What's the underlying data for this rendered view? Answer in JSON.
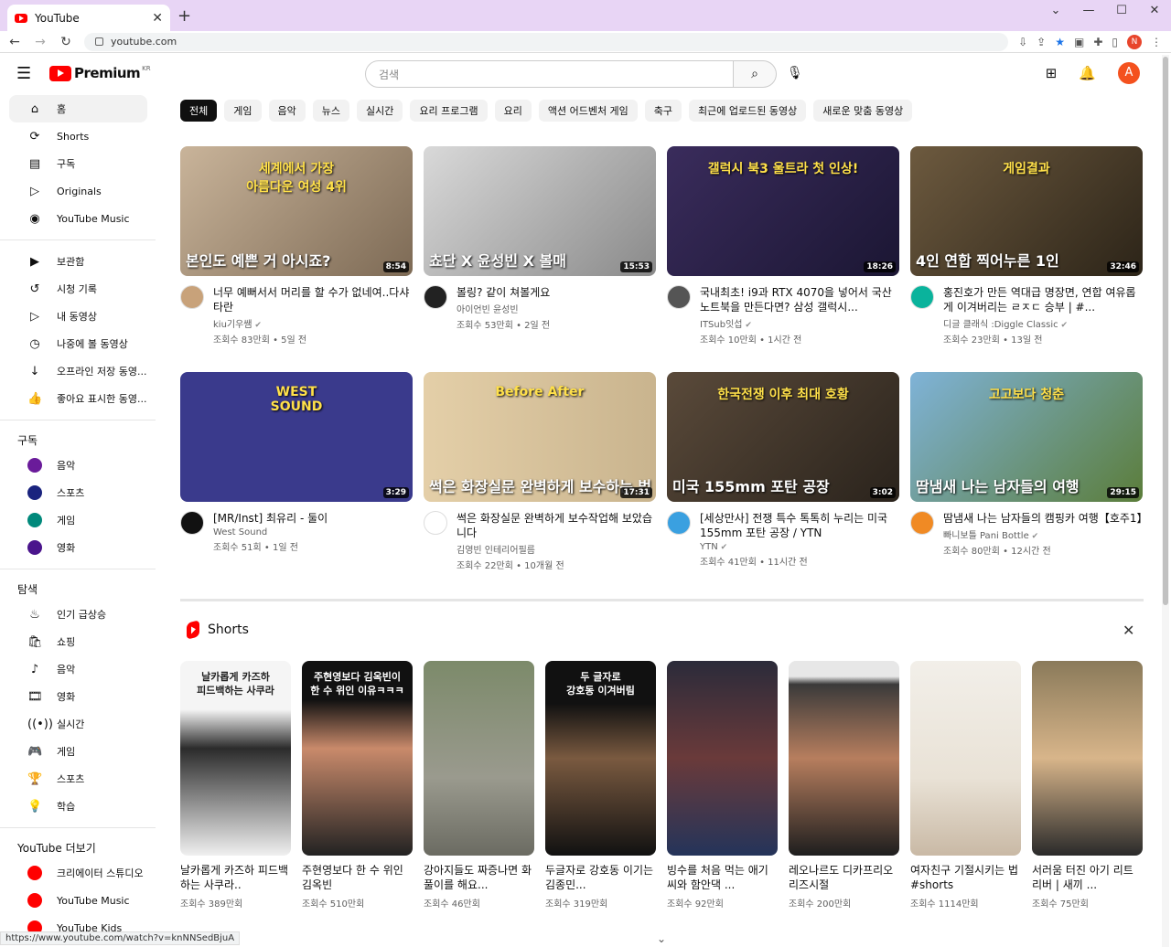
{
  "browser": {
    "tab_title": "YouTube",
    "tab_close": "✕",
    "new_tab": "+",
    "url": "youtube.com",
    "status_url": "https://www.youtube.com/watch?v=knNNSedBjuA"
  },
  "header": {
    "logo_text": "Premium",
    "region": "KR",
    "search_placeholder": "검색",
    "avatar_letter": "A"
  },
  "sidebar": {
    "main": [
      {
        "label": "홈",
        "icon": "home-icon",
        "glyph": "⌂"
      },
      {
        "label": "Shorts",
        "icon": "shorts-icon",
        "glyph": "⟳"
      },
      {
        "label": "구독",
        "icon": "subscriptions-icon",
        "glyph": "▤"
      },
      {
        "label": "Originals",
        "icon": "originals-icon",
        "glyph": "▷"
      },
      {
        "label": "YouTube Music",
        "icon": "music-icon",
        "glyph": "◉"
      }
    ],
    "library": [
      {
        "label": "보관함",
        "icon": "library-icon",
        "glyph": "▶"
      },
      {
        "label": "시청 기록",
        "icon": "history-icon",
        "glyph": "↺"
      },
      {
        "label": "내 동영상",
        "icon": "your-videos-icon",
        "glyph": "▷"
      },
      {
        "label": "나중에 볼 동영상",
        "icon": "watch-later-icon",
        "glyph": "◷"
      },
      {
        "label": "오프라인 저장 동영...",
        "icon": "download-icon",
        "glyph": "↓"
      },
      {
        "label": "좋아요 표시한 동영...",
        "icon": "like-icon",
        "glyph": "👍"
      }
    ],
    "subs_heading": "구독",
    "subs": [
      {
        "label": "음악",
        "color": "#6a1b9a"
      },
      {
        "label": "스포츠",
        "color": "#1a237e"
      },
      {
        "label": "게임",
        "color": "#00897b"
      },
      {
        "label": "영화",
        "color": "#4a148c"
      }
    ],
    "explore_heading": "탐색",
    "explore": [
      {
        "label": "인기 급상승",
        "icon": "trending-icon",
        "glyph": "♨"
      },
      {
        "label": "쇼핑",
        "icon": "shopping-icon",
        "glyph": "🛍"
      },
      {
        "label": "음악",
        "icon": "music-note-icon",
        "glyph": "♪"
      },
      {
        "label": "영화",
        "icon": "movies-icon",
        "glyph": "🎞"
      },
      {
        "label": "실시간",
        "icon": "live-icon",
        "glyph": "((•))"
      },
      {
        "label": "게임",
        "icon": "gaming-icon",
        "glyph": "🎮"
      },
      {
        "label": "스포츠",
        "icon": "trophy-icon",
        "glyph": "🏆"
      },
      {
        "label": "학습",
        "icon": "learning-icon",
        "glyph": "💡"
      }
    ],
    "more_heading": "YouTube 더보기",
    "more": [
      {
        "label": "크리에이터 스튜디오",
        "color": "#ff0000"
      },
      {
        "label": "YouTube Music",
        "color": "#ff0000"
      },
      {
        "label": "YouTube Kids",
        "color": "#ff0000"
      }
    ]
  },
  "chips": [
    "전체",
    "게임",
    "음악",
    "뉴스",
    "실시간",
    "요리 프로그램",
    "요리",
    "액션 어드벤처 게임",
    "축구",
    "최근에 업로드된 동영상",
    "새로운 맞춤 동영상"
  ],
  "videos": [
    {
      "title": "너무 예뻐서서 머리를 할 수가 없네여..다샤 타란",
      "channel": "kiu기우쌤",
      "verified": true,
      "stats": "조회수 83만회 • 5일 전",
      "duration": "8:54",
      "caption": "본인도 예쁜 거 아시죠?",
      "overlay": "세계에서 가장\n아름다운 여성 4위",
      "bg": "linear-gradient(135deg,#c9b49a,#7d6a55)",
      "avatar": "#c8a27a"
    },
    {
      "title": "볼링? 같이 쳐볼게요",
      "channel": "아이언빈 윤성빈",
      "verified": false,
      "stats": "조회수 53만회 • 2일 전",
      "duration": "15:53",
      "caption": "쵸단 X 윤성빈 X 볼매",
      "overlay": "",
      "bg": "linear-gradient(135deg,#d9d9d9,#8a8a8a)",
      "avatar": "#222"
    },
    {
      "title": "국내최초! i9과 RTX 4070을 넣어서 국산 노트북을 만든다면? 삼성 갤럭시...",
      "channel": "ITSub잇섭",
      "verified": true,
      "stats": "조회수 10만회 • 1시간 전",
      "duration": "18:26",
      "caption": "",
      "overlay": "갤럭시 북3 울트라 첫 인상!",
      "bg": "linear-gradient(135deg,#3a2c5c,#1b1633)",
      "avatar": "#555"
    },
    {
      "title": "홍진호가 만든 역대급 명장면, 연합 여유롭게 이겨버리는 ㄹㅈㄷ 승부 | #...",
      "channel": "디글 클래식 :Diggle Classic",
      "verified": true,
      "stats": "조회수 23만회 • 13일 전",
      "duration": "32:46",
      "caption": "4인 연합 찍어누른 1인",
      "overlay": "게임결과",
      "bg": "linear-gradient(135deg,#6d5a3f,#2c2418)",
      "avatar": "#0ab39c"
    },
    {
      "title": "[MR/Inst] 최유리 - 둘이",
      "channel": "West Sound",
      "verified": false,
      "stats": "조회수 51회 • 1일 전",
      "duration": "3:29",
      "caption": "",
      "overlay": "WEST\nSOUND",
      "bg": "#3a3a8c",
      "avatar": "#111"
    },
    {
      "title": "썩은 화장실문 완벽하게 보수작업해 보았습니다",
      "channel": "김영빈 인테리어필름",
      "verified": false,
      "stats": "조회수 22만회 • 10개월 전",
      "duration": "17:31",
      "caption": "썩은 화장실문 완벽하게 보수하는 법",
      "overlay": "Before        After",
      "bg": "linear-gradient(90deg,#e4cfa8,#c9b48e)",
      "avatar": "#fff"
    },
    {
      "title": "[세상만사] 전쟁 특수 톡톡히 누리는 미국 155mm 포탄 공장 / YTN",
      "channel": "YTN",
      "verified": true,
      "stats": "조회수 41만회 • 11시간 전",
      "duration": "3:02",
      "caption": "미국 155mm 포탄 공장",
      "overlay": "한국전쟁 이후 최대 호황",
      "bg": "linear-gradient(135deg,#5a4a3a,#2a231c)",
      "avatar": "#3aa0e0"
    },
    {
      "title": "땀냄새 나는 남자들의 캠핑카 여행【호주1】",
      "channel": "빠니보틀 Pani Bottle",
      "verified": true,
      "stats": "조회수 80만회 • 12시간 전",
      "duration": "29:15",
      "caption": "땀냄새 나는 남자들의 여행",
      "overlay": "고고보다 청춘",
      "bg": "linear-gradient(135deg,#7fb3d8,#5b7d3a)",
      "avatar": "#f08a24"
    }
  ],
  "shorts_heading": "Shorts",
  "shorts": [
    {
      "title": "날카롭게 카즈하 피드백하는 사쿠라..",
      "views": "조회수 389만회",
      "overlay": "날카롭게 카즈하\n피드백하는 사쿠라",
      "bg": "linear-gradient(180deg,#f5f5f5 0%,#f5f5f5 25%,#2b2b2b 45%,#f0f0f0 100%)",
      "dark": false
    },
    {
      "title": "주현영보다 한 수 위인 김옥빈",
      "views": "조회수 510만회",
      "overlay": "주현영보다 김옥빈이\n한 수 위인 이유ㅋㅋㅋ",
      "bg": "linear-gradient(180deg,#111 0%,#111 20%,#c98a6b 45%,#222 100%)",
      "dark": true
    },
    {
      "title": "강아지들도 짜증나면 화풀이를 해요...",
      "views": "조회수 46만회",
      "overlay": "",
      "bg": "linear-gradient(180deg,#7c8a6a,#9a9a8e 60%,#6b6b62)",
      "dark": false
    },
    {
      "title": "두글자로 강호동 이기는 김종민...",
      "views": "조회수 319만회",
      "overlay": "두 글자로\n강호동 이겨버림",
      "bg": "linear-gradient(180deg,#111 0%,#111 22%,#7a5a40 50%,#111 100%)",
      "dark": true
    },
    {
      "title": "빙수를 처음 먹는 애기씨와 함안댁 ...",
      "views": "조회수 92만회",
      "overlay": "",
      "bg": "linear-gradient(180deg,#2b2b3a,#6a3a3a 50%,#24345a)",
      "dark": true
    },
    {
      "title": "레오나르도 디카프리오 리즈시절",
      "views": "조회수 200만회",
      "overlay": "",
      "bg": "linear-gradient(180deg,#e7e7e7 0%,#e7e7e7 8%,#3a3a3a 12%,#b77e5e 50%,#1e1e1e 100%)",
      "dark": true
    },
    {
      "title": "여자친구 기절시키는 법 #shorts",
      "views": "조회수 1114만회",
      "overlay": "",
      "bg": "linear-gradient(180deg,#f2efe9,#e9e2d6 60%,#c9b9a5)",
      "dark": false
    },
    {
      "title": "서러움 터진 아기 리트리버 | 새끼 ...",
      "views": "조회수 75만회",
      "overlay": "",
      "bg": "linear-gradient(180deg,#8a7a5a,#d8b58a 50%,#2a2a2a)",
      "dark": false
    }
  ]
}
